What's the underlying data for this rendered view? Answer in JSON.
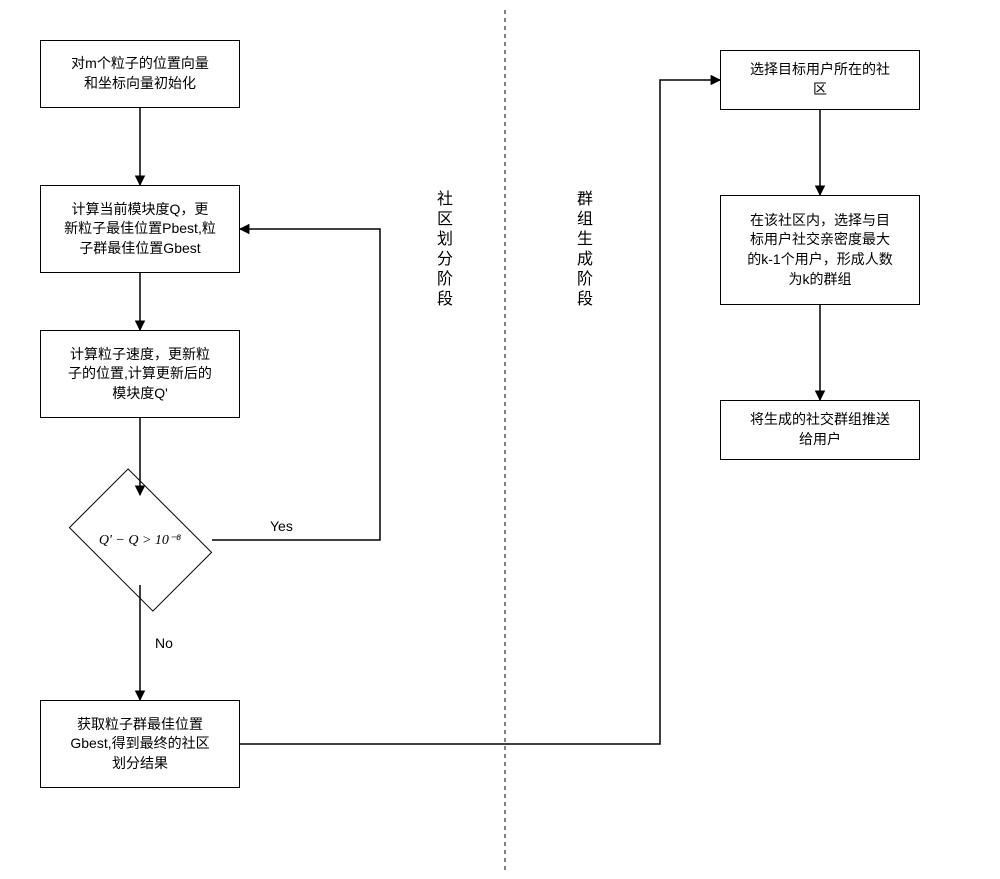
{
  "leftPhaseLabel": "社区划分阶段",
  "rightPhaseLabel": "群组生成阶段",
  "nodes": {
    "init": {
      "text": "对m个粒子的位置向量\n和坐标向量初始化"
    },
    "calcQ": {
      "text": "计算当前模块度Q，更\n新粒子最佳位置Pbest,粒\n子群最佳位置Gbest"
    },
    "update": {
      "text": "计算粒子速度，更新粒\n子的位置,计算更新后的\n模块度Q'"
    },
    "cond": {
      "text": "Q' − Q > 10⁻⁸"
    },
    "result": {
      "text": "获取粒子群最佳位置\nGbest,得到最终的社区\n划分结果"
    },
    "select": {
      "text": "选择目标用户所在的社\n区"
    },
    "formK": {
      "text": "在该社区内，选择与目\n标用户社交亲密度最大\n的k-1个用户，形成人数\n为k的群组"
    },
    "push": {
      "text": "将生成的社交群组推送\n给用户"
    }
  },
  "edgeLabels": {
    "yes": "Yes",
    "no": "No"
  },
  "chart_data": {
    "type": "flowchart",
    "title": "",
    "phases": [
      {
        "name": "社区划分阶段",
        "nodes": [
          "init",
          "calcQ",
          "update",
          "cond",
          "result"
        ]
      },
      {
        "name": "群组生成阶段",
        "nodes": [
          "select",
          "formK",
          "push"
        ]
      }
    ],
    "nodes": [
      {
        "id": "init",
        "type": "process",
        "label": "对m个粒子的位置向量和坐标向量初始化"
      },
      {
        "id": "calcQ",
        "type": "process",
        "label": "计算当前模块度Q，更新粒子最佳位置Pbest,粒子群最佳位置Gbest"
      },
      {
        "id": "update",
        "type": "process",
        "label": "计算粒子速度，更新粒子的位置,计算更新后的模块度Q'"
      },
      {
        "id": "cond",
        "type": "decision",
        "label": "Q' − Q > 10⁻⁸"
      },
      {
        "id": "result",
        "type": "process",
        "label": "获取粒子群最佳位置Gbest,得到最终的社区划分结果"
      },
      {
        "id": "select",
        "type": "process",
        "label": "选择目标用户所在的社区"
      },
      {
        "id": "formK",
        "type": "process",
        "label": "在该社区内，选择与目标用户社交亲密度最大的k-1个用户，形成人数为k的群组"
      },
      {
        "id": "push",
        "type": "process",
        "label": "将生成的社交群组推送给用户"
      }
    ],
    "edges": [
      {
        "from": "init",
        "to": "calcQ"
      },
      {
        "from": "calcQ",
        "to": "update"
      },
      {
        "from": "update",
        "to": "cond"
      },
      {
        "from": "cond",
        "to": "calcQ",
        "label": "Yes"
      },
      {
        "from": "cond",
        "to": "result",
        "label": "No"
      },
      {
        "from": "result",
        "to": "select"
      },
      {
        "from": "select",
        "to": "formK"
      },
      {
        "from": "formK",
        "to": "push"
      }
    ]
  }
}
